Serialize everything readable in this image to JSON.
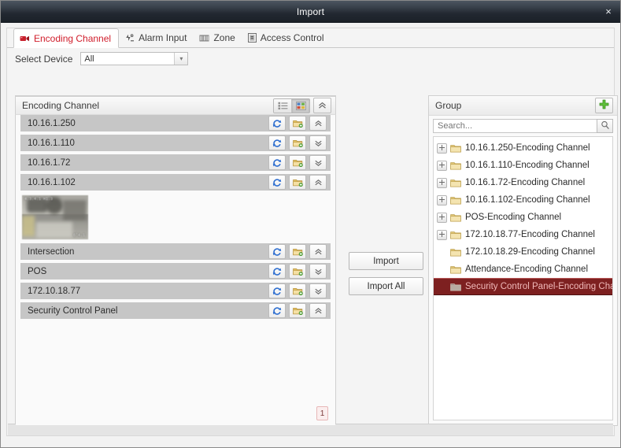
{
  "window": {
    "title": "Import",
    "close_label": "×"
  },
  "tabs": [
    {
      "label": "Encoding Channel",
      "icon": "camera-icon",
      "active": true
    },
    {
      "label": "Alarm Input",
      "icon": "alarm-input-icon",
      "active": false
    },
    {
      "label": "Zone",
      "icon": "zone-icon",
      "active": false
    },
    {
      "label": "Access Control",
      "icon": "access-control-icon",
      "active": false
    }
  ],
  "select_device": {
    "label": "Select Device",
    "value": "All",
    "options": [
      "All"
    ]
  },
  "left_panel": {
    "title": "Encoding Channel",
    "view_list_icon": "list-view-icon",
    "view_thumbnail_icon": "thumbnail-view-icon",
    "collapse_all_icon": "collapse-all-icon",
    "rows": [
      {
        "name": "10.16.1.250",
        "refresh_icon": "refresh-icon",
        "add_group_icon": "add-to-group-icon",
        "expand_icon": "chevron-up-icon",
        "expanded": true
      },
      {
        "name": "10.16.1.110",
        "refresh_icon": "refresh-icon",
        "add_group_icon": "add-to-group-icon",
        "expand_icon": "chevron-down-icon",
        "expanded": false
      },
      {
        "name": "10.16.1.72",
        "refresh_icon": "refresh-icon",
        "add_group_icon": "add-to-group-icon",
        "expand_icon": "chevron-down-icon",
        "expanded": false
      },
      {
        "name": "10.16.1.102",
        "refresh_icon": "refresh-icon",
        "add_group_icon": "add-to-group-icon",
        "expand_icon": "chevron-up-icon",
        "expanded": true
      }
    ],
    "thumbnail": {
      "osd_top": "4.3.4.1  H1.3",
      "osd_bottom": "6'4.1"
    },
    "rows_after_thumbnail": [
      {
        "name": "Intersection",
        "refresh_icon": "refresh-icon",
        "add_group_icon": "add-to-group-icon",
        "expand_icon": "chevron-up-icon",
        "expanded": true
      },
      {
        "name": "POS",
        "refresh_icon": "refresh-icon",
        "add_group_icon": "add-to-group-icon",
        "expand_icon": "chevron-down-icon",
        "expanded": false
      },
      {
        "name": "172.10.18.77",
        "refresh_icon": "refresh-icon",
        "add_group_icon": "add-to-group-icon",
        "expand_icon": "chevron-down-icon",
        "expanded": false
      },
      {
        "name": "Security Control Panel",
        "refresh_icon": "refresh-icon",
        "add_group_icon": "add-to-group-icon",
        "expand_icon": "chevron-up-icon",
        "expanded": true
      }
    ],
    "page_badge": "1"
  },
  "middle": {
    "import_label": "Import",
    "import_all_label": "Import All"
  },
  "right_panel": {
    "title": "Group",
    "add_icon": "plus-icon",
    "search": {
      "placeholder": "Search...",
      "value": "",
      "icon": "search-icon"
    },
    "tree": [
      {
        "label": "10.16.1.250-Encoding Channel",
        "expandable": true,
        "selected": false,
        "icon": "folder-icon"
      },
      {
        "label": "10.16.1.110-Encoding Channel",
        "expandable": true,
        "selected": false,
        "icon": "folder-icon"
      },
      {
        "label": "10.16.1.72-Encoding Channel",
        "expandable": true,
        "selected": false,
        "icon": "folder-icon"
      },
      {
        "label": "10.16.1.102-Encoding Channel",
        "expandable": true,
        "selected": false,
        "icon": "folder-icon"
      },
      {
        "label": "POS-Encoding Channel",
        "expandable": true,
        "selected": false,
        "icon": "folder-icon"
      },
      {
        "label": "172.10.18.77-Encoding Channel",
        "expandable": true,
        "selected": false,
        "icon": "folder-icon"
      },
      {
        "label": "172.10.18.29-Encoding Channel",
        "expandable": false,
        "selected": false,
        "icon": "folder-icon"
      },
      {
        "label": "Attendance-Encoding Channel",
        "expandable": false,
        "selected": false,
        "icon": "folder-icon"
      },
      {
        "label": "Security Control Panel-Encoding Channel",
        "expandable": false,
        "selected": true,
        "icon": "folder-icon"
      }
    ]
  },
  "colors": {
    "accent_red": "#d01c2a",
    "selected_row": "#7d2020",
    "selected_text": "#f0b9b9",
    "titlebar_dark": "#222831",
    "row_gray": "#c6c6c6",
    "green_plus": "#55b234",
    "blue_refresh": "#2f6fd0",
    "folder_yellow": "#e8c66a"
  }
}
